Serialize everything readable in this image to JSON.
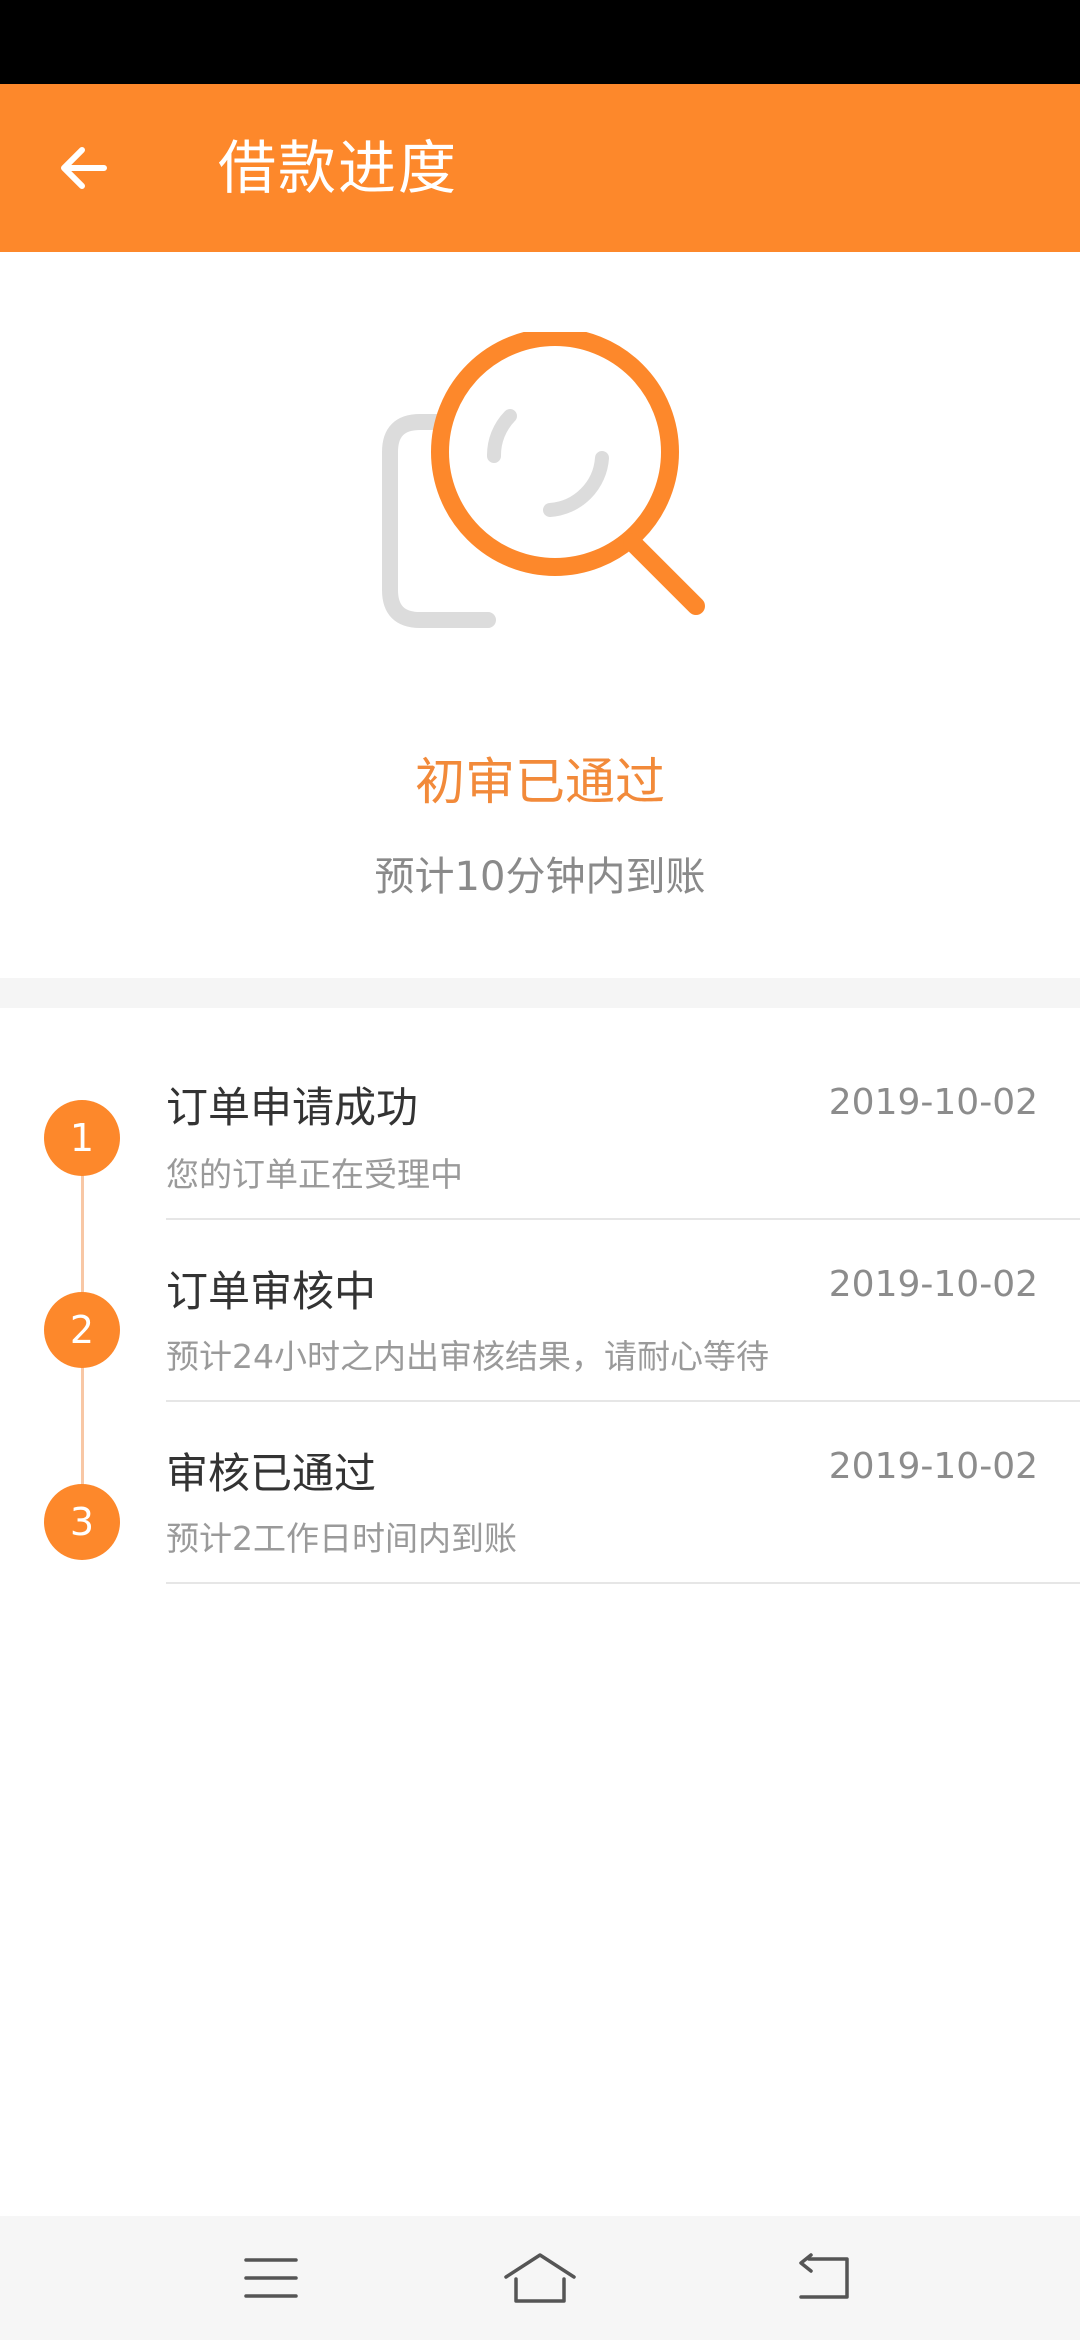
{
  "header": {
    "title": "借款进度",
    "back_icon": "arrow-left-icon"
  },
  "status": {
    "icon": "magnifier-document-icon",
    "title": "初审已通过",
    "subtitle": "预计10分钟内到账"
  },
  "steps": [
    {
      "number": "1",
      "title": "订单申请成功",
      "date": "2019-10-02",
      "desc": "您的订单正在受理中"
    },
    {
      "number": "2",
      "title": "订单审核中",
      "date": "2019-10-02",
      "desc": "预计24小时之内出审核结果，请耐心等待"
    },
    {
      "number": "3",
      "title": "审核已通过",
      "date": "2019-10-02",
      "desc": "预计2工作日时间内到账"
    }
  ],
  "nav": {
    "menu_icon": "menu-icon",
    "home_icon": "home-icon",
    "back_icon": "back-icon"
  },
  "colors": {
    "accent": "#fd882b",
    "status_text": "#f28a3a",
    "timeline_line": "#f8c7a5"
  }
}
